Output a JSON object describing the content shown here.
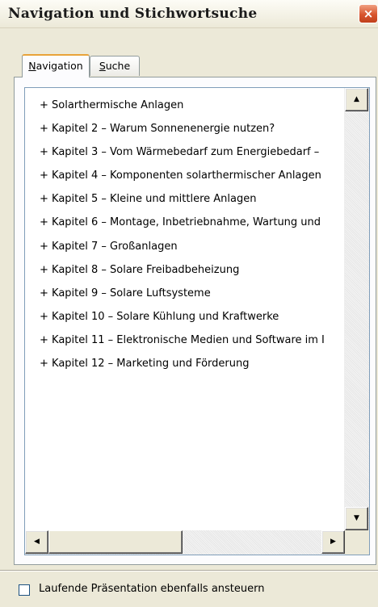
{
  "window": {
    "title": "Navigation und Stichwortsuche",
    "close_icon": "×"
  },
  "tabs": [
    {
      "label": "Navigation",
      "accelerator": "N",
      "rest": "avigation",
      "active": true
    },
    {
      "label": "Suche",
      "accelerator": "S",
      "rest": "uche",
      "active": false
    }
  ],
  "tree": {
    "items": [
      "+ Solarthermische Anlagen",
      "+ Kapitel 2 – Warum Sonnenenergie nutzen?",
      "+ Kapitel 3 – Vom Wärmebedarf zum  Energiebedarf –",
      "+ Kapitel 4 – Komponenten  solarthermischer Anlagen",
      "+ Kapitel 5 – Kleine und mittlere Anlagen",
      "+ Kapitel 6 – Montage, Inbetriebnahme,  Wartung und",
      "+ Kapitel 7 – Großanlagen",
      "+ Kapitel 8 – Solare Freibadbeheizung",
      "+ Kapitel 9 – Solare Luftsysteme",
      "+ Kapitel 10 – Solare Kühlung und Kraftwerke",
      "+ Kapitel 11 – Elektronische Medien und  Software im I",
      "+ Kapitel 12 – Marketing und Förderung"
    ]
  },
  "scrollbar": {
    "up_icon": "▲",
    "down_icon": "▼",
    "left_icon": "◀",
    "right_icon": "▶"
  },
  "footer": {
    "checkbox_label": "Laufende Präsentation ebenfalls ansteuern",
    "checkbox_checked": false
  }
}
